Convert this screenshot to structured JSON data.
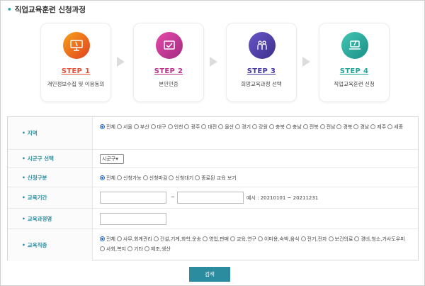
{
  "page": {
    "title": "직업교육훈련 신청과정"
  },
  "steps": [
    {
      "num": "STEP 1",
      "desc": "개인정보수집 및 이용동의",
      "color": "#e2543a",
      "icon": "monitor-pencil-icon"
    },
    {
      "num": "STEP 2",
      "desc": "본인인증",
      "color": "#b8328a",
      "icon": "certificate-icon"
    },
    {
      "num": "STEP 3",
      "desc": "희망교육과정 선택",
      "color": "#453a9c",
      "icon": "people-icon"
    },
    {
      "num": "STEP 4",
      "desc": "직업교육훈련 신청",
      "color": "#23a49a",
      "icon": "laptop-pen-icon"
    }
  ],
  "form": {
    "region": {
      "label": "지역",
      "options": [
        "전체",
        "서울",
        "부산",
        "대구",
        "인천",
        "광주",
        "대전",
        "울산",
        "경기",
        "강원",
        "충북",
        "충남",
        "전북",
        "전남",
        "경북",
        "경남",
        "제주",
        "세종"
      ],
      "selected": "전체"
    },
    "district": {
      "label": "시군구 선택",
      "value": "시군구"
    },
    "status": {
      "label": "신청구분",
      "options": [
        "전체",
        "신청가능",
        "신청마감",
        "신청대기",
        "종료된 교육 보기"
      ],
      "selected": "전체"
    },
    "period": {
      "label": "교육기간",
      "separator": "~",
      "example": "예시 : 20210101 ~ 20211231",
      "from": "",
      "to": ""
    },
    "course": {
      "label": "교육과정명",
      "value": ""
    },
    "category": {
      "label": "교육직종",
      "options": [
        "전체",
        "사무,회계관리",
        "건설,기계,화학,운송",
        "영업,판매",
        "교육,연구",
        "이미용,숙박,음식",
        "전기,전자",
        "보건의료",
        "경비,청소,가사도우미",
        "사회,복지",
        "기타",
        "제조,생산"
      ],
      "selected": "전체"
    }
  },
  "search_label": "검색"
}
